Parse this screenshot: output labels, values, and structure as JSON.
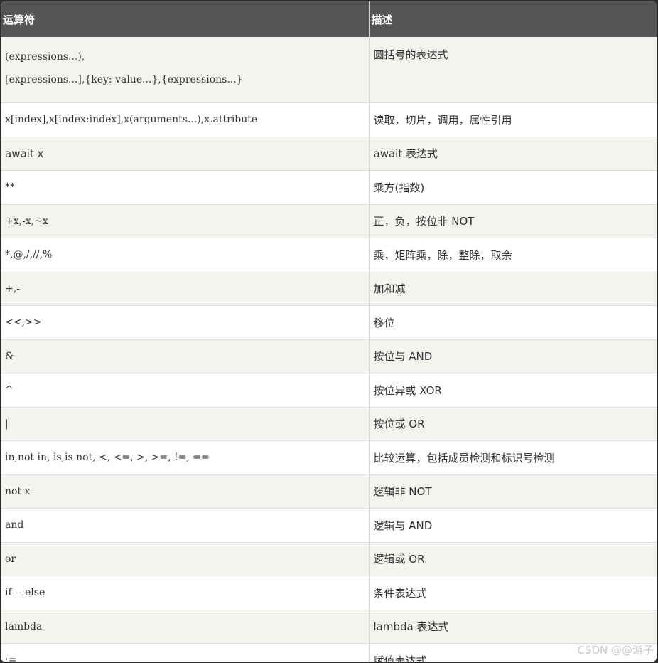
{
  "table": {
    "headers": [
      "运算符",
      "描述"
    ],
    "rows": [
      {
        "op_lines": [
          "(expressions...),",
          "[expressions...],{key: value...},{expressions...}"
        ],
        "desc": "圆括号的表达式"
      },
      {
        "op": "x[index],x[index:index],x(arguments...),x.attribute",
        "desc": "读取，切片，调用，属性引用"
      },
      {
        "op": "await x",
        "desc": "await 表达式"
      },
      {
        "op": "**",
        "desc": "乘方(指数)"
      },
      {
        "op": "+x,-x,~x",
        "desc": "正，负，按位非 NOT"
      },
      {
        "op": "*,@,/,//,%",
        "desc": "乘，矩阵乘，除，整除，取余"
      },
      {
        "op": "+,-",
        "desc": "加和减"
      },
      {
        "op": "<<,>>",
        "desc": "移位"
      },
      {
        "op": "&",
        "desc": "按位与 AND"
      },
      {
        "op": "^",
        "desc": "按位异或 XOR"
      },
      {
        "op": "|",
        "desc": "按位或 OR"
      },
      {
        "op": "in,not in, is,is not, <, <=, >, >=, !=, ==",
        "desc": "比较运算，包括成员检测和标识号检测"
      },
      {
        "op": "not x",
        "desc": "逻辑非 NOT"
      },
      {
        "op": "and",
        "desc": "逻辑与 AND"
      },
      {
        "op": "or",
        "desc": "逻辑或 OR"
      },
      {
        "op": "if -- else",
        "desc": "条件表达式"
      },
      {
        "op": "lambda",
        "desc": "lambda 表达式"
      },
      {
        "op": ":=",
        "desc": "赋值表达式"
      }
    ]
  },
  "watermark": "CSDN @@游子",
  "colors": {
    "header_bg": "#555555",
    "row_alt_bg": "#f4f3f0",
    "row_bg": "#ffffff",
    "text": "#333333"
  }
}
